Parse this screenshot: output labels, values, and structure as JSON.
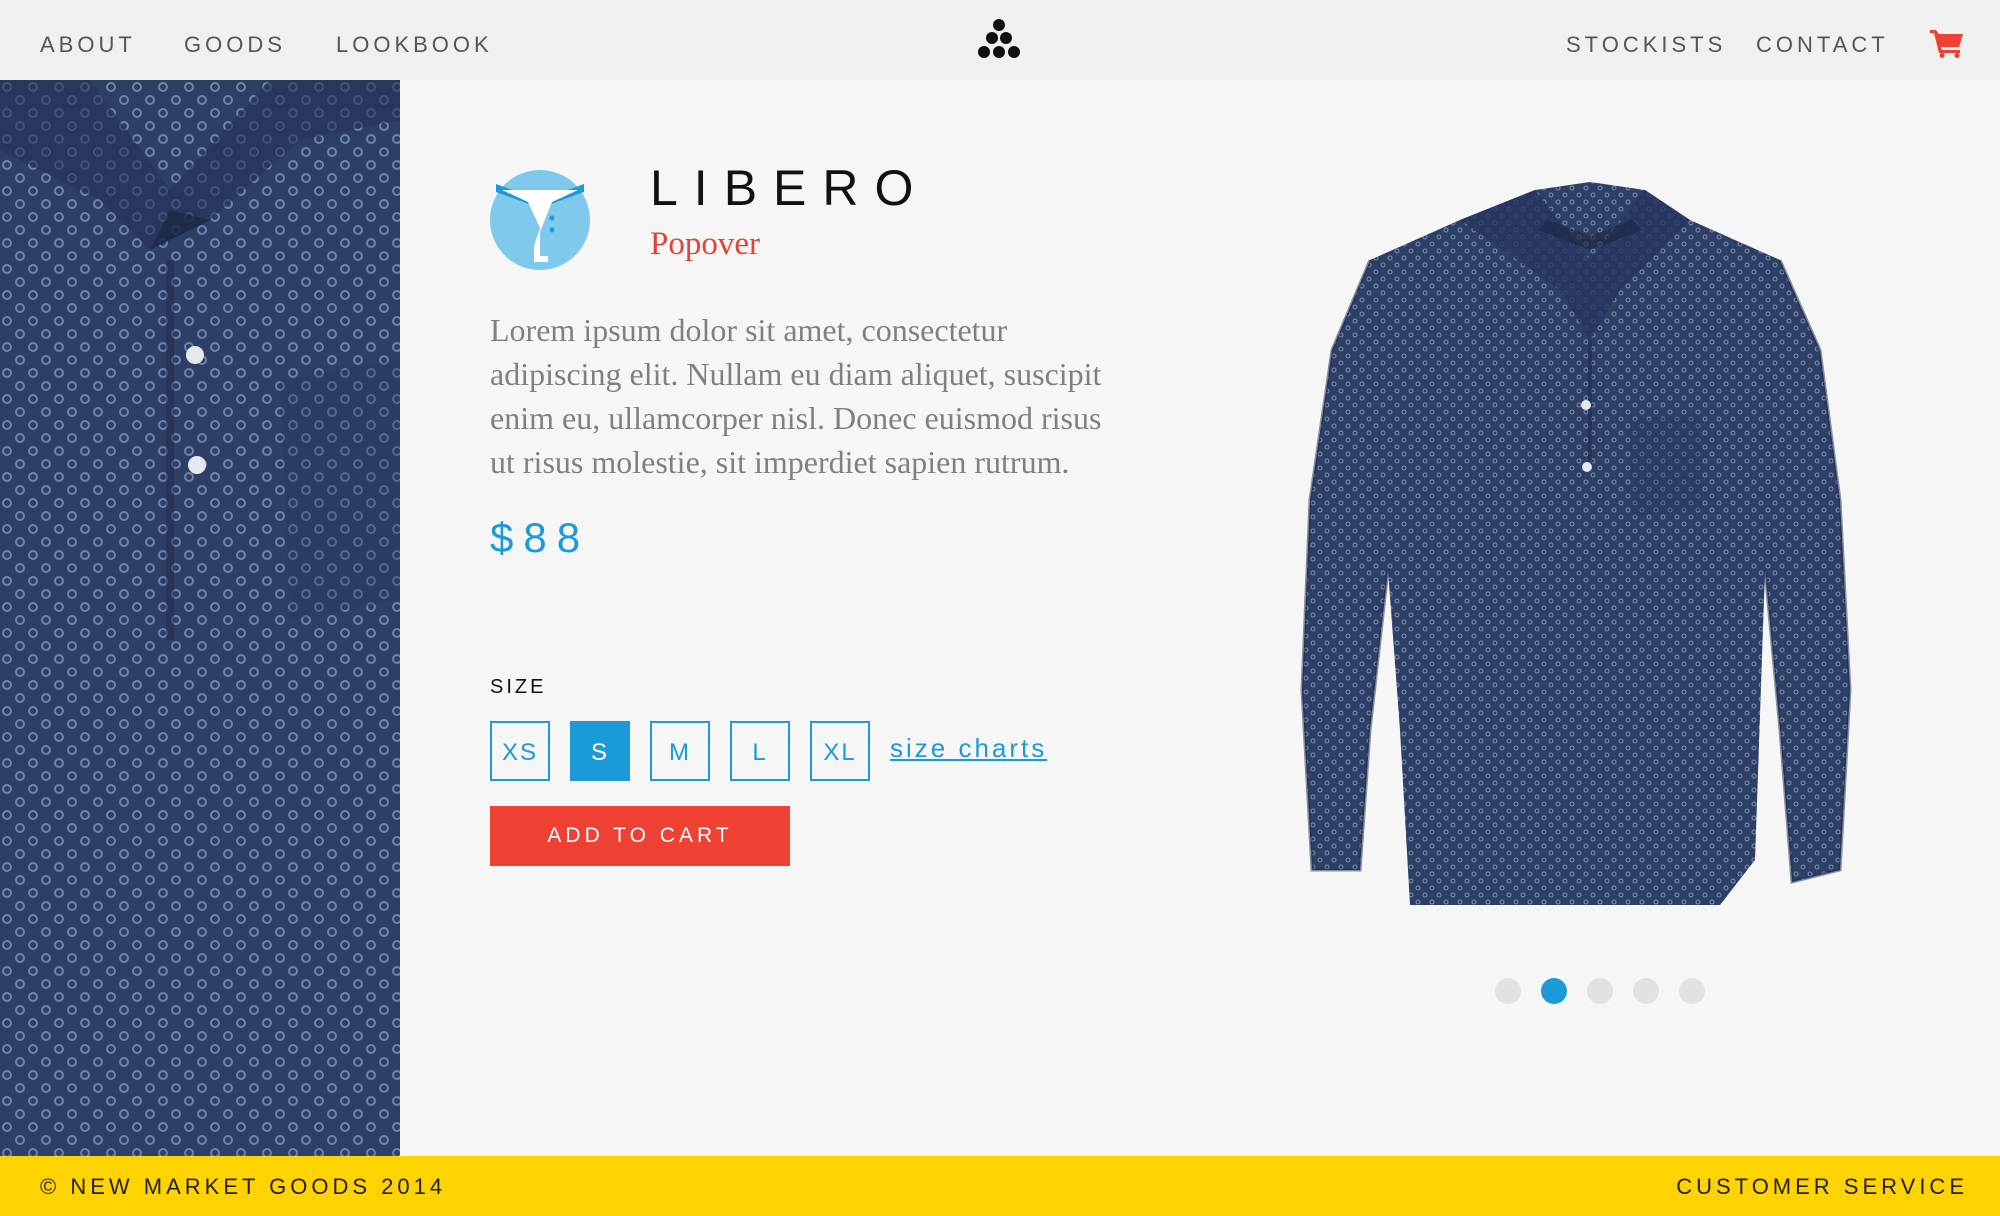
{
  "nav": {
    "left": [
      "ABOUT",
      "GOODS",
      "LOOKBOOK"
    ],
    "right": [
      "STOCKISTS",
      "CONTACT"
    ],
    "logo_icon": "dots-pyramid-icon",
    "cart_icon": "shopping-cart-icon"
  },
  "product": {
    "name": "LIBERO",
    "subtitle": "Popover",
    "icon": "shirt-collar-icon",
    "description": "Lorem ipsum dolor sit amet, consectetur adipiscing elit. Nullam eu diam aliquet, suscipit enim eu, ullamcorper nisl. Donec euismod risus ut risus molestie, sit imperdiet sapien rutrum.",
    "price": "$88"
  },
  "size": {
    "label": "SIZE",
    "options": [
      "XS",
      "S",
      "M",
      "L",
      "XL"
    ],
    "selected": "S",
    "charts_link": "size charts"
  },
  "add_to_cart": "ADD TO CART",
  "carousel": {
    "count": 5,
    "active_index": 1
  },
  "footer": {
    "copyright": "© NEW MARKET GOODS 2014",
    "service": "CUSTOMER SERVICE"
  },
  "colors": {
    "accent_blue": "#1a9ad6",
    "cart_red": "#ee4033",
    "subtitle_red": "#e04436",
    "footer_yellow": "#fed300",
    "shirt_navy": "#2e3f66"
  }
}
